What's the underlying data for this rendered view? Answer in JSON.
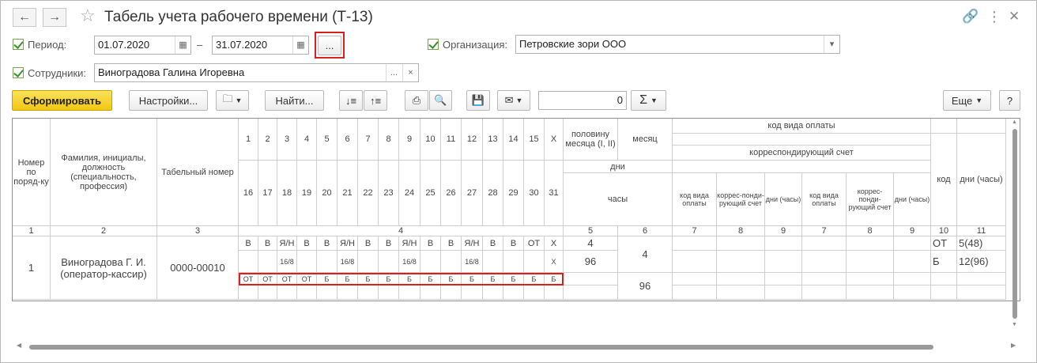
{
  "window": {
    "title": "Табель учета рабочего времени (Т-13)",
    "icons": [
      "back-arrow-icon",
      "forward-arrow-icon",
      "favorite-star-icon",
      "link-icon",
      "more-menu-icon",
      "close-icon"
    ]
  },
  "period": {
    "label": "Период:",
    "from": "01.07.2020",
    "dash": "–",
    "to": "31.07.2020",
    "select_button": "..."
  },
  "organization": {
    "label": "Организация:",
    "value": "Петровские зори ООО"
  },
  "employees": {
    "label": "Сотрудники:",
    "value": "Виноградова Галина Игоревна",
    "select_button": "...",
    "clear_button": "×"
  },
  "toolbar": {
    "generate": "Сформировать",
    "settings": "Настройки...",
    "find": "Найти...",
    "sum_value": "0",
    "sum_symbol": "Σ",
    "more": "Еще",
    "help": "?"
  },
  "table": {
    "headers": {
      "num": "Номер по поряд-ку",
      "name": "Фамилия, инициалы, должность (специальность, профессия)",
      "tab": "Табельный номер",
      "days_top": [
        "1",
        "2",
        "3",
        "4",
        "5",
        "6",
        "7",
        "8",
        "9",
        "10",
        "11",
        "12",
        "13",
        "14",
        "15",
        "X"
      ],
      "days_bottom": [
        "16",
        "17",
        "18",
        "19",
        "20",
        "21",
        "22",
        "23",
        "24",
        "25",
        "26",
        "27",
        "28",
        "29",
        "30",
        "31"
      ],
      "half_month": "половину месяца (I, II)",
      "month": "месяц",
      "dni": "дни",
      "chasy": "часы",
      "pay_code_title": "код вида оплаты",
      "corr_title": "корреспондирующий счет",
      "pay_code": "код вида оплаты",
      "corr": "коррес-понди-рующий счет",
      "days_hours": "дни (часы)",
      "kod": "код",
      "dni_chasy": "дни (часы)"
    },
    "col_numbers": [
      "1",
      "2",
      "3",
      "4",
      "5",
      "6",
      "7",
      "8",
      "9",
      "7",
      "8",
      "9",
      "10",
      "11"
    ],
    "row": {
      "num": "1",
      "name": "Виноградова Г. И. (оператор-кассир)",
      "tab": "0000-00010",
      "codes_top": [
        "В",
        "В",
        "Я/Н",
        "В",
        "В",
        "Я/Н",
        "В",
        "В",
        "Я/Н",
        "В",
        "В",
        "Я/Н",
        "В",
        "В",
        "ОТ",
        "Х"
      ],
      "hours_top": [
        "",
        "",
        "16/8",
        "",
        "",
        "16/8",
        "",
        "",
        "16/8",
        "",
        "",
        "16/8",
        "",
        "",
        "",
        "Х"
      ],
      "codes_bottom": [
        "ОТ",
        "ОТ",
        "ОТ",
        "ОТ",
        "Б",
        "Б",
        "Б",
        "Б",
        "Б",
        "Б",
        "Б",
        "Б",
        "Б",
        "Б",
        "Б",
        "Б"
      ],
      "half_days": "4",
      "half_hours": "96",
      "month_days": "4",
      "month_hours": "96",
      "code1": "ОТ",
      "days1": "5(48)",
      "code2": "Б",
      "days2": "12(96)"
    }
  }
}
